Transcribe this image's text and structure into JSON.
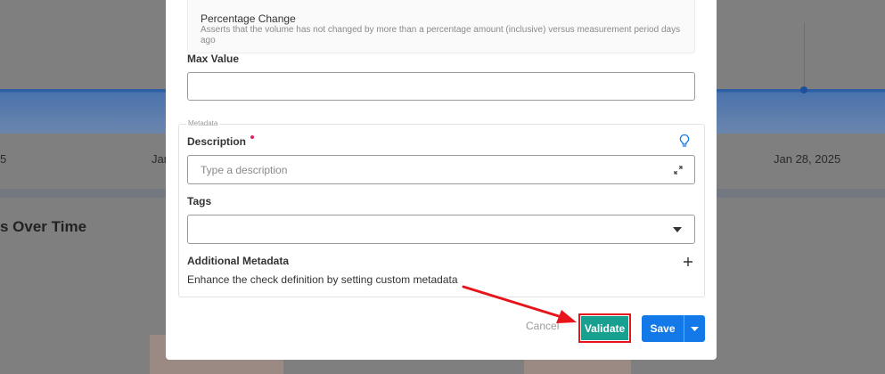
{
  "background": {
    "ticks": [
      "5",
      "Jan",
      "Jan 28, 2025"
    ],
    "section_title": "s Over Time"
  },
  "modal": {
    "option": {
      "title": "Percentage Change",
      "description": "Asserts that the volume has not changed by more than a percentage amount (inclusive) versus measurement period days ago"
    },
    "max_value": {
      "label": "Max Value",
      "value": ""
    },
    "metadata": {
      "legend": "Metadata",
      "description": {
        "label": "Description",
        "placeholder": "Type a description",
        "value": ""
      },
      "tags": {
        "label": "Tags",
        "value": ""
      },
      "additional": {
        "label": "Additional Metadata",
        "help": "Enhance the check definition by setting custom metadata"
      }
    },
    "footer": {
      "cancel_label": "Cancel",
      "validate_label": "Validate",
      "save_label": "Save"
    }
  },
  "colors": {
    "accent_teal": "#17a090",
    "primary_blue": "#1378e8",
    "annotation_red": "#e8141c",
    "required": "#e0245e"
  }
}
